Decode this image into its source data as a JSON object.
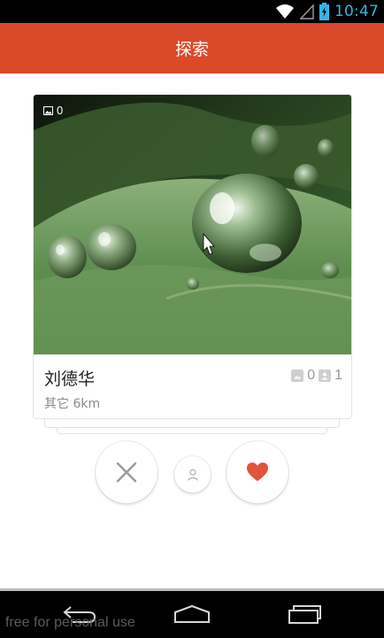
{
  "status_bar": {
    "time": "10:47"
  },
  "header": {
    "title": "探索"
  },
  "card": {
    "photo_count": "0",
    "name": "刘德华",
    "subtitle": "其它 6km",
    "stat_photos": "0",
    "stat_friends": "1"
  },
  "actions": {
    "dislike_icon": "close-icon",
    "profile_icon": "person-icon",
    "like_icon": "heart-icon",
    "like_color": "#e2533b"
  },
  "nav": {
    "back_icon": "back-icon",
    "home_icon": "home-icon",
    "recent_icon": "recent-apps-icon"
  },
  "watermark": "free for personal use"
}
